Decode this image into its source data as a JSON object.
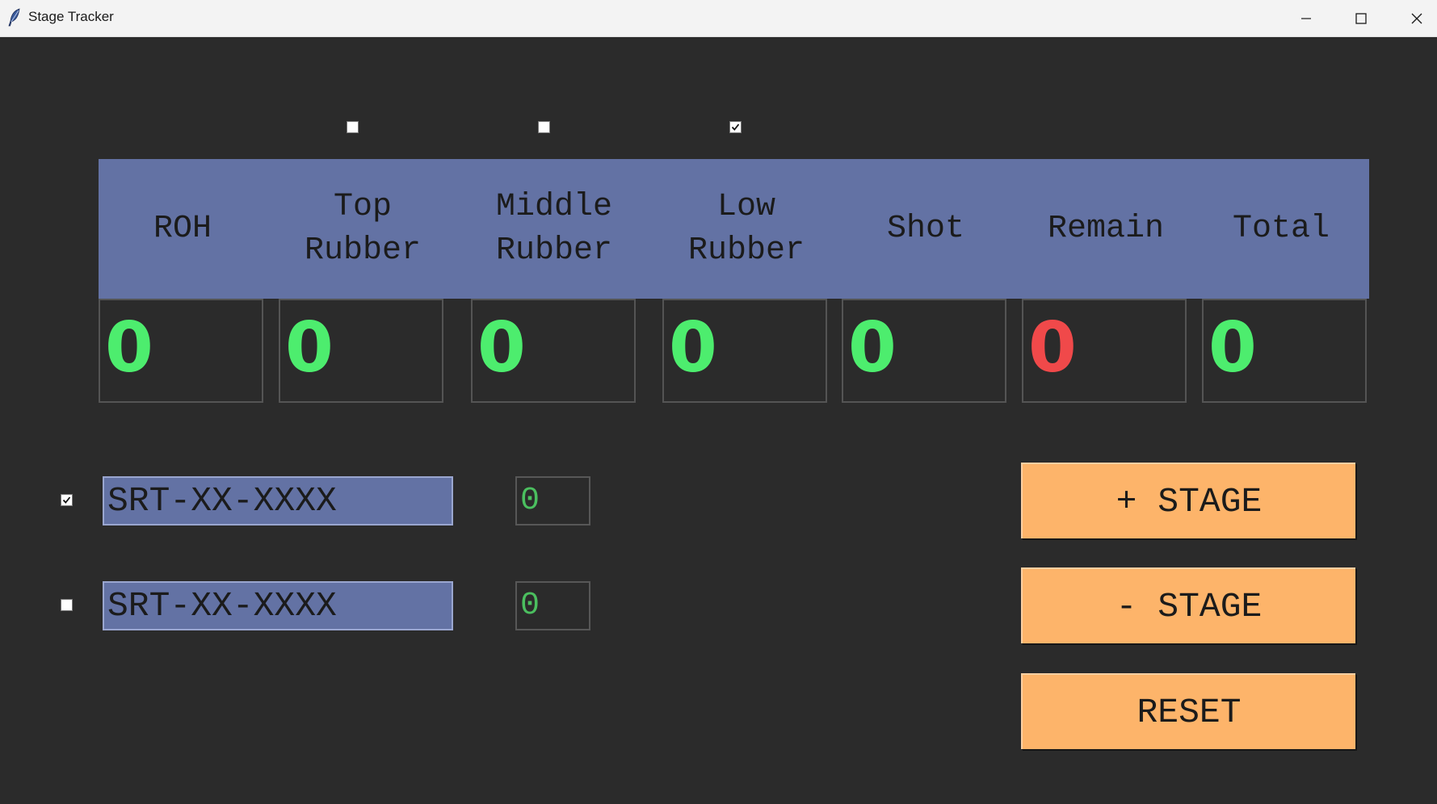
{
  "window": {
    "title": "Stage Tracker"
  },
  "icons": {
    "app": "feather-icon",
    "minimize": "minimize-icon",
    "maximize": "maximize-icon",
    "close": "close-icon"
  },
  "column_toggles": [
    {
      "column": "Top Rubber",
      "checked": false
    },
    {
      "column": "Middle Rubber",
      "checked": false
    },
    {
      "column": "Low Rubber",
      "checked": true
    }
  ],
  "headers": [
    "ROH",
    "Top\nRubber",
    "Middle\nRubber",
    "Low\nRubber",
    "Shot",
    "Remain",
    "Total"
  ],
  "counters": [
    {
      "value": "0",
      "color": "#4ded6e"
    },
    {
      "value": "0",
      "color": "#4ded6e"
    },
    {
      "value": "0",
      "color": "#4ded6e"
    },
    {
      "value": "0",
      "color": "#4ded6e"
    },
    {
      "value": "0",
      "color": "#4ded6e"
    },
    {
      "value": "0",
      "color": "#f0494a"
    },
    {
      "value": "0",
      "color": "#4ded6e"
    }
  ],
  "serial_rows": [
    {
      "checked": true,
      "serial": "SRT-XX-XXXX",
      "count": "0"
    },
    {
      "checked": false,
      "serial": "SRT-XX-XXXX",
      "count": "0"
    }
  ],
  "buttons": {
    "add_stage": "+ STAGE",
    "remove_stage": "- STAGE",
    "reset": "RESET"
  },
  "colors": {
    "background": "#2b2b2b",
    "header_band": "#6372a4",
    "counter_green": "#4ded6e",
    "counter_red": "#f0494a",
    "button": "#fdb46a"
  }
}
